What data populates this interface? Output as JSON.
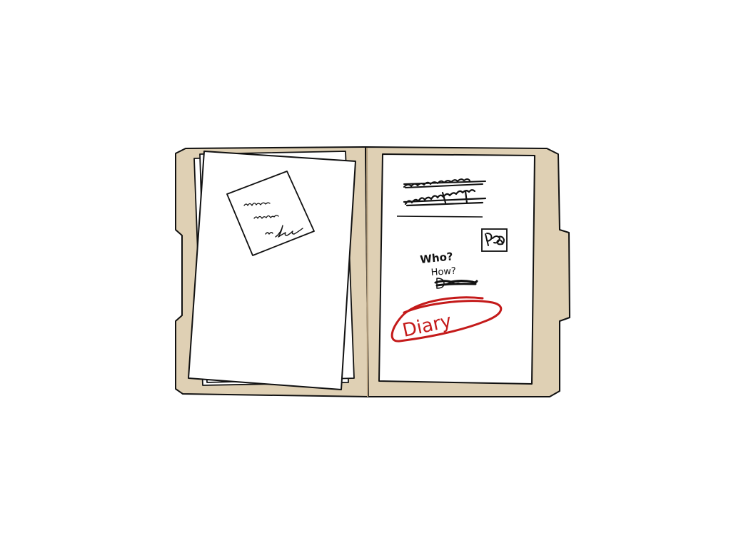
{
  "illustration": {
    "folder_color": "#dfd0b4",
    "paper_color": "#ffffff",
    "ink_color": "#111111",
    "accent_color": "#c41a1a"
  },
  "right_page": {
    "question_words": [
      "Who?",
      "How?"
    ],
    "highlight_label": "Diary"
  }
}
